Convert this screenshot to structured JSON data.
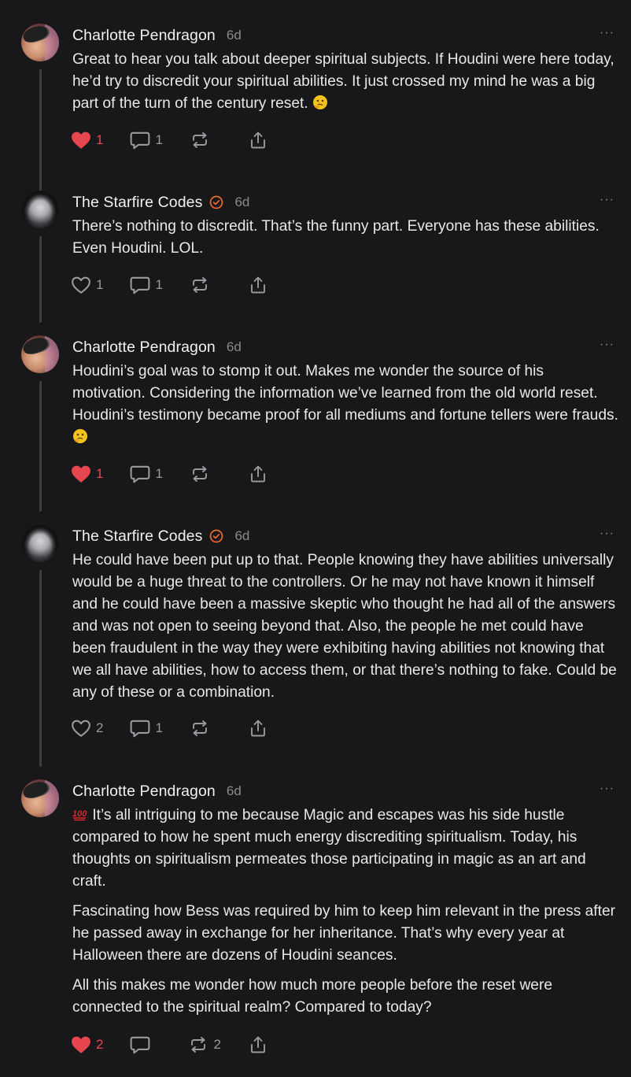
{
  "comments": [
    {
      "author": "Charlotte Pendragon",
      "verified": false,
      "time": "6d",
      "more": "···",
      "paragraphs": [
        "Great to hear you talk about deeper spiritual subjects. If Houdini were here today, he’d try to discredit your spiritual abilities. It just crossed my mind he was a big part of the turn of the century reset."
      ],
      "trailing_emoji": "thinking-face",
      "likes": "1",
      "liked": true,
      "replies": "1",
      "restacks": ""
    },
    {
      "author": "The Starfire Codes",
      "verified": true,
      "time": "6d",
      "more": "···",
      "paragraphs": [
        "There’s nothing to discredit. That’s the funny part. Everyone has these abilities. Even Houdini. LOL."
      ],
      "likes": "1",
      "liked": false,
      "replies": "1",
      "restacks": ""
    },
    {
      "author": "Charlotte Pendragon",
      "verified": false,
      "time": "6d",
      "more": "···",
      "paragraphs": [
        "Houdini’s goal was to stomp it out. Makes me wonder the source of his motivation. Considering the information we’ve learned from the old world reset. Houdini’s testimony became proof for all mediums and fortune tellers were frauds."
      ],
      "trailing_emoji": "thinking-face",
      "likes": "1",
      "liked": true,
      "replies": "1",
      "restacks": ""
    },
    {
      "author": "The Starfire Codes",
      "verified": true,
      "time": "6d",
      "more": "···",
      "paragraphs": [
        "He could have been put up to that. People knowing they have abilities universally would be a huge threat to the controllers. Or he may not have known it himself and he could have been a massive skeptic who thought he had all of the answers and was not open to seeing beyond that. Also, the people he met could have been fraudulent in the way they were exhibiting having abilities not knowing that we all have abilities, how to access them, or that there’s nothing to fake. Could be any of these or a combination."
      ],
      "likes": "2",
      "liked": false,
      "replies": "1",
      "restacks": ""
    },
    {
      "author": "Charlotte Pendragon",
      "verified": false,
      "time": "6d",
      "more": "···",
      "leading_emoji": "hundred-points",
      "paragraphs": [
        "It’s all intriguing to me because Magic and escapes was his side hustle compared to how he spent much energy discrediting spiritualism. Today, his thoughts on spiritualism permeates those participating in magic as an art and craft.",
        "Fascinating how Bess was required by him to keep him relevant in the press after he passed away in exchange for her inheritance. That’s why every year at Halloween there are dozens of Houdini seances.",
        "All this makes me wonder how much more people before the reset were connected to the spiritual realm? Compared to today?"
      ],
      "likes": "2",
      "liked": true,
      "replies": "",
      "restacks": "2"
    }
  ],
  "colors": {
    "heart": "#e8464f",
    "icon": "#9a9a9e",
    "verified": "#f06a2e"
  }
}
